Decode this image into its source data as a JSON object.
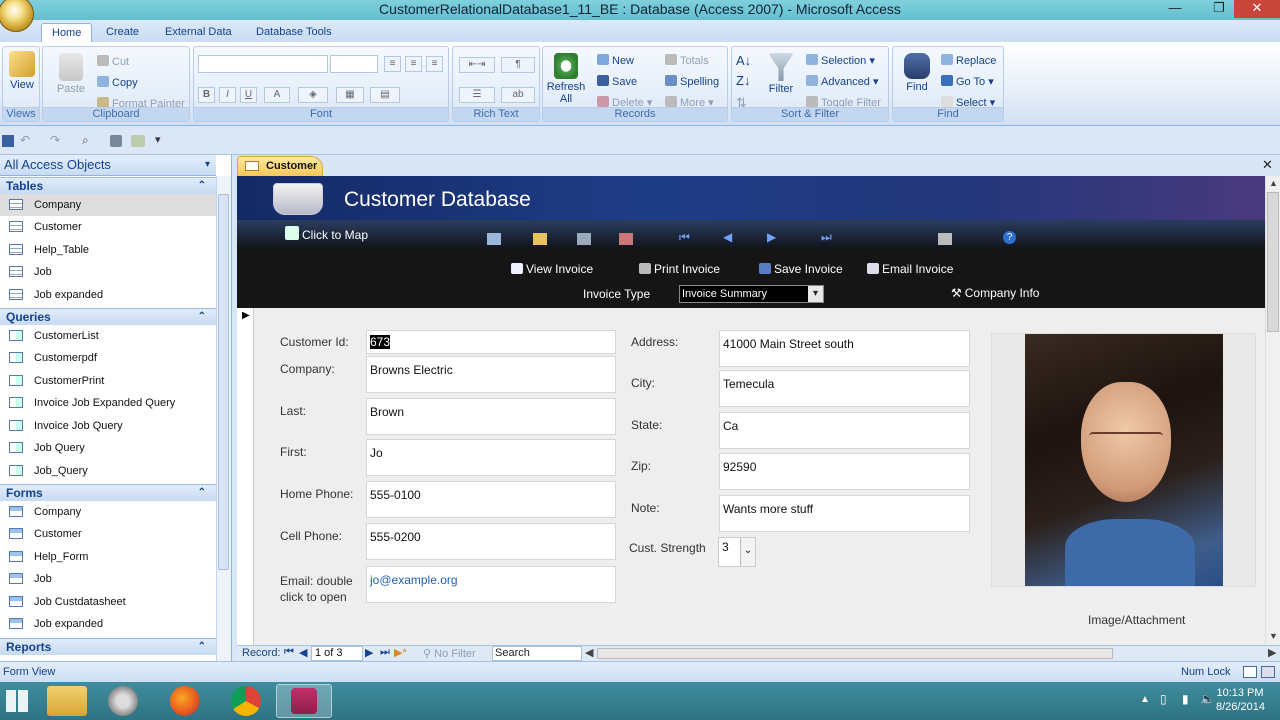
{
  "window": {
    "title": "CustomerRelationalDatabase1_11_BE : Database (Access 2007) - Microsoft Access"
  },
  "ribbon": {
    "tabs": [
      "Home",
      "Create",
      "External Data",
      "Database Tools"
    ],
    "views": {
      "view": "View",
      "label": "Views"
    },
    "clipboard": {
      "paste": "Paste",
      "cut": "Cut",
      "copy": "Copy",
      "format_painter": "Format Painter",
      "label": "Clipboard"
    },
    "font": {
      "label": "Font"
    },
    "rich_text": {
      "label": "Rich Text"
    },
    "records": {
      "refresh": "Refresh",
      "refresh2": "All",
      "new": "New",
      "save": "Save",
      "delete": "Delete",
      "totals": "Totals",
      "spelling": "Spelling",
      "more": "More",
      "label": "Records"
    },
    "sort_filter": {
      "filter": "Filter",
      "selection": "Selection",
      "advanced": "Advanced",
      "toggle": "Toggle Filter",
      "label": "Sort & Filter"
    },
    "find": {
      "find": "Find",
      "replace": "Replace",
      "goto": "Go To",
      "select": "Select",
      "label": "Find"
    }
  },
  "nav": {
    "header": "All Access Objects",
    "tables_label": "Tables",
    "tables": [
      "Company",
      "Customer",
      "Help_Table",
      "Job",
      "Job expanded"
    ],
    "queries_label": "Queries",
    "queries": [
      "CustomerList",
      "Customerpdf",
      "CustomerPrint",
      "Invoice Job Expanded Query",
      "Invoice Job Query",
      "Job Query",
      "Job_Query"
    ],
    "forms_label": "Forms",
    "forms": [
      "Company",
      "Customer",
      "Help_Form",
      "Job",
      "Job Custdatasheet",
      "Job expanded"
    ],
    "reports_label": "Reports"
  },
  "doc_tab": "Customer",
  "form": {
    "title": "Customer Database",
    "click_to_map": "Click to Map",
    "view_invoice": "View Invoice",
    "print_invoice": "Print Invoice",
    "save_invoice": "Save Invoice",
    "email_invoice": "Email Invoice",
    "invoice_type_label": "Invoice Type",
    "invoice_type_value": "Invoice Summary",
    "company_info": "Company Info",
    "labels": {
      "customer_id": "Customer Id:",
      "company": "Company:",
      "last": "Last:",
      "first": "First:",
      "home_phone": "Home Phone:",
      "cell_phone": "Cell Phone:",
      "email_1": "Email: double",
      "email_2": "click to open",
      "address": "Address:",
      "city": "City:",
      "state": "State:",
      "zip": "Zip:",
      "note": "Note:",
      "cust_strength": "Cust. Strength",
      "image": "Image/Attachment"
    },
    "values": {
      "customer_id": "673",
      "company": "Browns Electric",
      "last": "Brown",
      "first": "Jo",
      "home_phone": "555-0100",
      "cell_phone": "555-0200",
      "email": "jo@example.org",
      "address": "41000 Main Street south",
      "city": "Temecula",
      "state": "Ca",
      "zip": "92590",
      "note": "Wants more stuff",
      "cust_strength": "3"
    }
  },
  "record_nav": {
    "record_label": "Record:",
    "position": "1 of 3",
    "no_filter": "No Filter",
    "search": "Search"
  },
  "status": {
    "left": "Form View",
    "num_lock": "Num Lock"
  },
  "taskbar": {
    "time": "10:13 PM",
    "date": "8/26/2014"
  },
  "colors": {
    "accent": "#15428b",
    "header_dark": "#1e3c86",
    "tab_gold": "#f7c857"
  }
}
